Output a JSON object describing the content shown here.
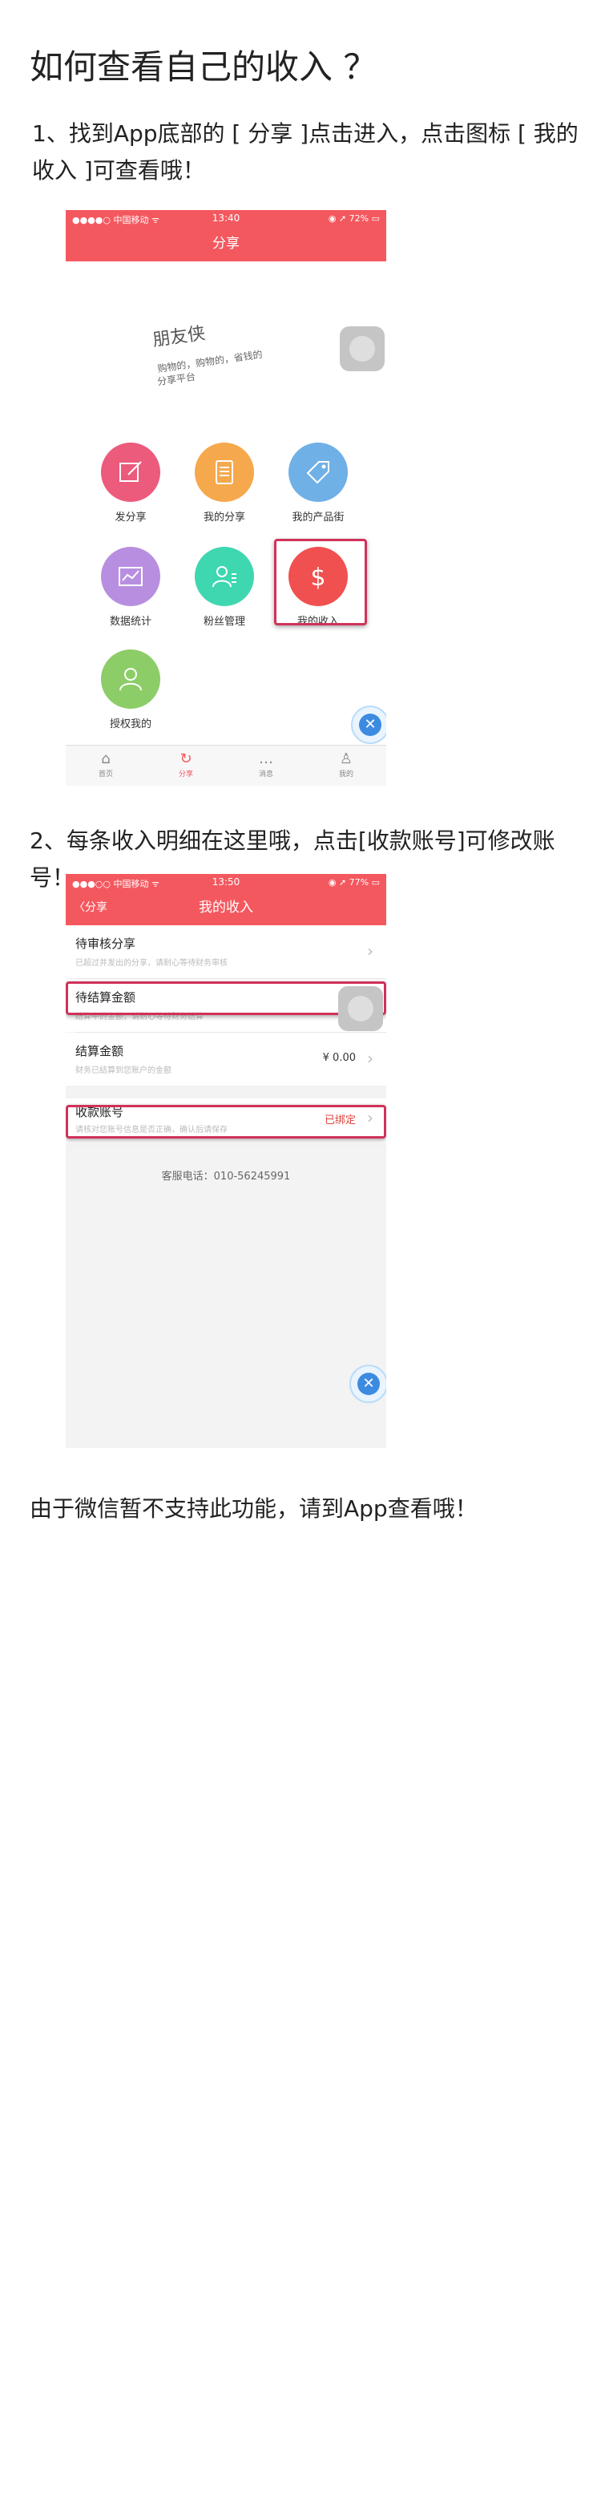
{
  "page": {
    "title": "如何查看自己的收入 ？",
    "step1": "1、找到App底部的 [ 分享 ]点击进入，点击图标 [ 我的收入 ]可查看哦！",
    "step2": "2、每条收入明细在这里哦，点击[收款账号]可修改账号！",
    "footer": "由于微信暂不支持此功能，请到App查看哦！"
  },
  "phone1": {
    "status": {
      "carrier": "●●●●○ 中国移动 ᯤ",
      "time": "13:40",
      "battery": "◉ ➚ 72% ▭"
    },
    "nav_title": "分享",
    "signature_lines": [
      "朋友侠",
      "购物的，购物的，省钱的",
      "分享平台"
    ],
    "grid": [
      {
        "label": "发分享",
        "icon": "edit-icon",
        "color": "#ec5a7c"
      },
      {
        "label": "我的分享",
        "icon": "document-icon",
        "color": "#f6a84c"
      },
      {
        "label": "我的产品街",
        "icon": "tag-icon",
        "color": "#6fb0e6"
      },
      {
        "label": "数据统计",
        "icon": "chart-icon",
        "color": "#b88fe0"
      },
      {
        "label": "粉丝管理",
        "icon": "fans-icon",
        "color": "#3fd7b0"
      },
      {
        "label": "我的收入",
        "icon": "dollar-icon",
        "color": "#f0504f"
      },
      {
        "label": "授权我的",
        "icon": "person-icon",
        "color": "#8ccd68"
      }
    ],
    "tabs": [
      {
        "label": "首页",
        "icon": "⌂"
      },
      {
        "label": "分享",
        "icon": "↻"
      },
      {
        "label": "消息",
        "icon": "…"
      },
      {
        "label": "我的",
        "icon": "♙"
      }
    ]
  },
  "phone2": {
    "status": {
      "carrier": "●●●○○ 中国移动 ᯤ",
      "time": "13:50",
      "battery": "◉ ➚ 77% ▭"
    },
    "back_label": "分享",
    "nav_title": "我的收入",
    "rows": [
      {
        "title": "待审核分享",
        "sub": "已超过并发出的分享，请耐心等待财务审核"
      },
      {
        "title": "待结算金额",
        "sub": "结算中的金额，请耐心等待财务结算"
      },
      {
        "title": "结算金额",
        "sub": "财务已结算到您账户的金额",
        "value": "¥ 0.00"
      },
      {
        "title": "收款账号",
        "sub": "请核对您账号信息是否正确，确认后请保存",
        "status": "已绑定"
      }
    ],
    "service_phone": "客服电话：010-56245991"
  },
  "colors": {
    "accent": "#f4585f",
    "highlight": "#d0325a"
  }
}
